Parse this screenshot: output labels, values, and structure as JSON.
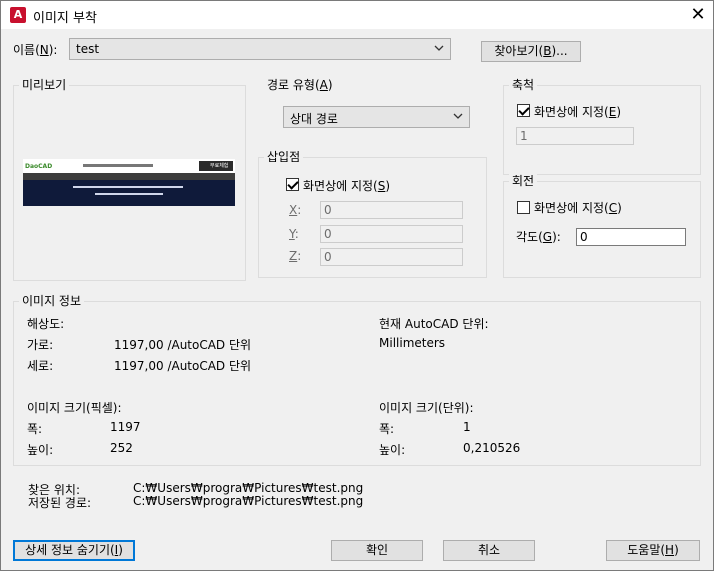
{
  "window": {
    "title": "이미지 부착",
    "app_icon": "A",
    "close_glyph": "✕"
  },
  "name_row": {
    "label": "이름(N):",
    "value": "test",
    "browse_button": "찾아보기(B)..."
  },
  "preview": {
    "legend": "미리보기",
    "thumb_brand": "DaoCAD",
    "thumb_button": "무료체험"
  },
  "path_type": {
    "legend": "경로 유형(A)",
    "value": "상대 경로"
  },
  "insertion": {
    "legend": "삽입점",
    "specify_on_screen": "화면상에 지정(S)",
    "x_label": "X:",
    "x_value": "0",
    "y_label": "Y:",
    "y_value": "0",
    "z_label": "Z:",
    "z_value": "0"
  },
  "scale": {
    "legend": "축척",
    "specify_on_screen": "화면상에 지정(E)",
    "value": "1"
  },
  "rotation": {
    "legend": "회전",
    "specify_on_screen": "화면상에 지정(C)",
    "angle_label": "각도(G):",
    "angle_value": "0"
  },
  "image_info": {
    "legend": "이미지 정보",
    "resolution_label": "해상도:",
    "horiz_label": "가로:",
    "horiz_value": "1197,00 /AutoCAD 단위",
    "vert_label": "세로:",
    "vert_value": "1197,00 /AutoCAD 단위",
    "current_unit_label": "현재 AutoCAD 단위:",
    "current_unit_value": "Millimeters",
    "size_px_label": "이미지 크기(픽셀):",
    "px_width_label": "폭:",
    "px_width_value": "1197",
    "px_height_label": "높이:",
    "px_height_value": "252",
    "size_unit_label": "이미지 크기(단위):",
    "unit_width_label": "폭:",
    "unit_width_value": "1",
    "unit_height_label": "높이:",
    "unit_height_value": "0,210526"
  },
  "paths": {
    "found_label": "찾은 위치:",
    "found_value": "C:₩Users₩progra₩Pictures₩test.png",
    "saved_label": "저장된 경로:",
    "saved_value": "C:₩Users₩progra₩Pictures₩test.png"
  },
  "buttons": {
    "hide_details": "상세 정보 숨기기(I)",
    "ok": "확인",
    "cancel": "취소",
    "help": "도움말(H)"
  }
}
